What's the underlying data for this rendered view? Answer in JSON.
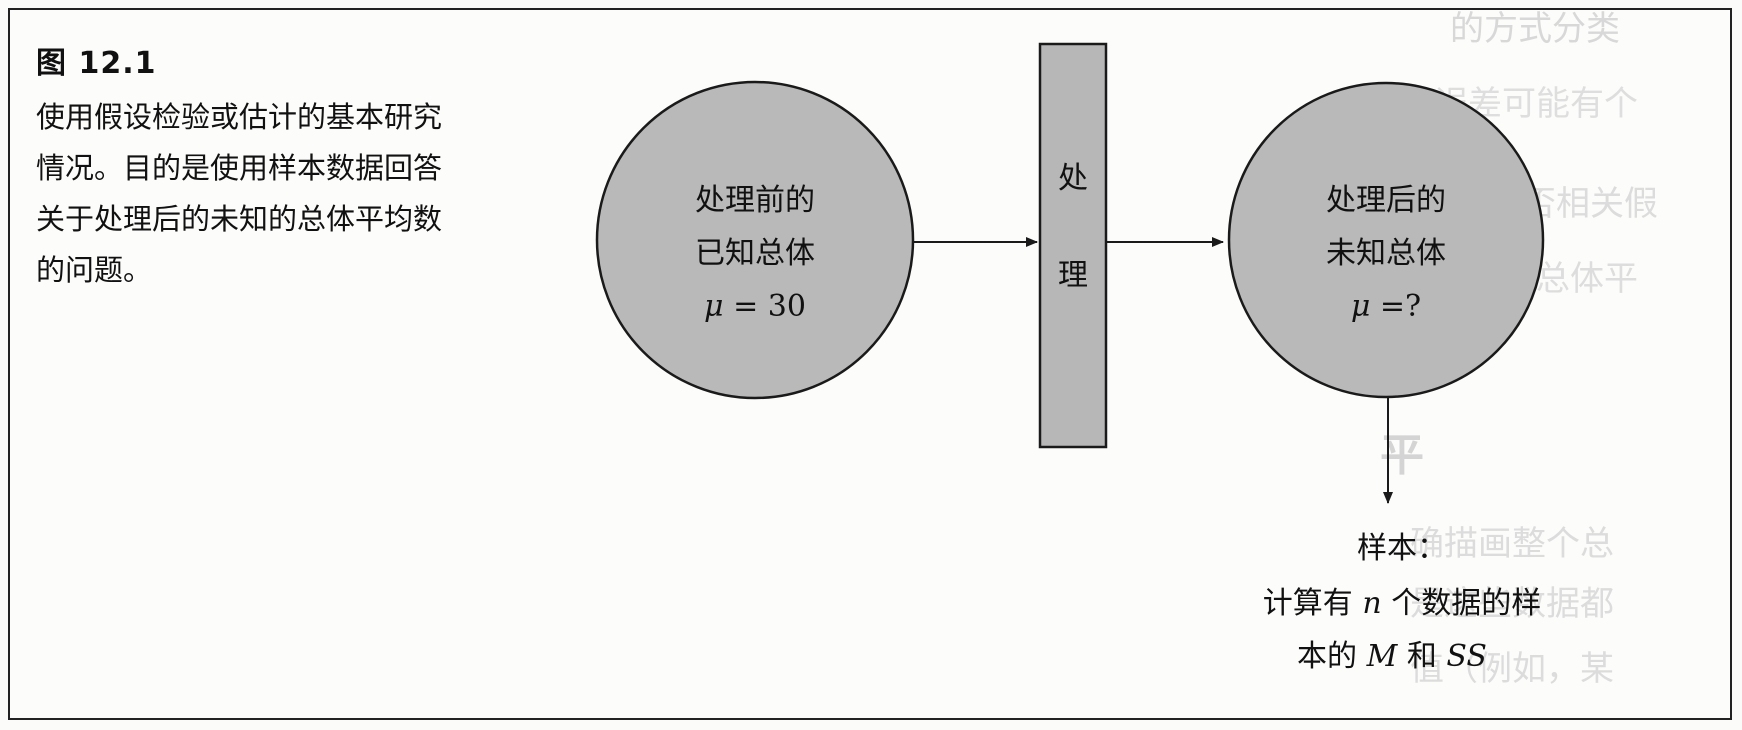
{
  "figure": {
    "label": "图 12.1",
    "caption_lines": [
      "使用假设检验或估计的基本研究",
      "情况。目的是使用样本数据回答",
      "关于处理后的未知的总体平均数",
      "的问题。"
    ]
  },
  "nodes": {
    "before": {
      "line1": "处理前的",
      "line2": "已知总体",
      "mu_symbol": "μ",
      "mu_eq": " = 30"
    },
    "treatment": {
      "char1": "处",
      "char2": "理"
    },
    "after": {
      "line1": "处理后的",
      "line2": "未知总体",
      "mu_symbol": "μ",
      "mu_eq": " =?"
    },
    "sample": {
      "line1": "样本：",
      "line2_a": "计算有 ",
      "line2_n": "n",
      "line2_b": " 个数据的样",
      "line3_a": "本的 ",
      "line3_m": "M",
      "line3_b": " 和 ",
      "line3_ss": "SS"
    }
  },
  "colors": {
    "circle_fill": "#b9b9b9",
    "box_fill": "#b7b7b7",
    "stroke": "#1a1a1a"
  }
}
